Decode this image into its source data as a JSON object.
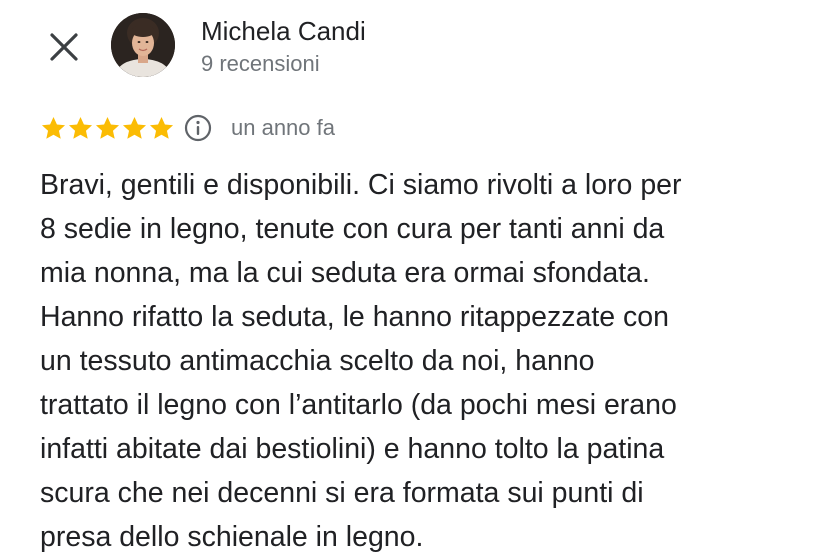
{
  "header": {
    "close_icon": "close-icon",
    "reviewer_name": "Michela Candi",
    "review_count": "9 recensioni"
  },
  "review": {
    "rating": 5,
    "max_rating": 5,
    "star_color": "#fbbc04",
    "info_icon": "info-icon",
    "date": "un anno fa",
    "text": "Bravi, gentili e disponibili. Ci siamo rivolti a loro per\n8 sedie in legno, tenute con cura per tanti anni da\nmia nonna, ma la cui seduta era ormai sfondata.\nHanno rifatto la seduta, le hanno ritappezzate con\nun tessuto antimacchia scelto da noi, hanno\ntrattato il legno con l’antitarlo (da pochi mesi erano\ninfatti abitate dai bestiolini) e hanno tolto la patina\nscura che nei decenni si era formata sui punti di\npresa dello schienale in legno."
  }
}
